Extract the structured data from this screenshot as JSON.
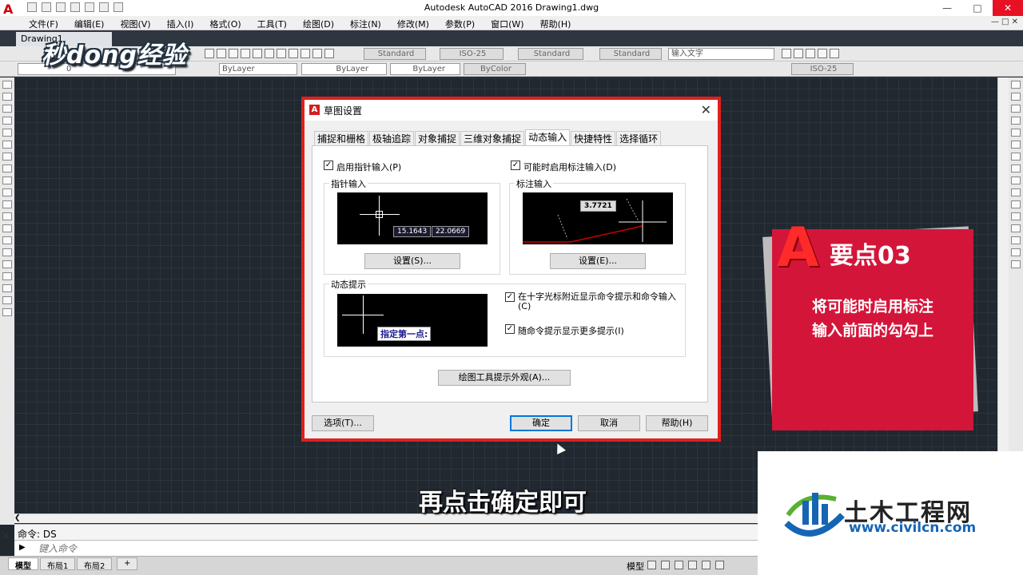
{
  "app": {
    "title": "Autodesk AutoCAD 2016    Drawing1.dwg",
    "logo_letter": "A"
  },
  "menu": [
    "文件(F)",
    "编辑(E)",
    "视图(V)",
    "插入(I)",
    "格式(O)",
    "工具(T)",
    "绘图(D)",
    "标注(N)",
    "修改(M)",
    "参数(P)",
    "窗口(W)",
    "帮助(H)"
  ],
  "doc_tab": "Drawing1",
  "toolbar1": {
    "text_style": "Standard",
    "dim_style": "ISO-25",
    "table_style": "Standard",
    "mleader_style": "Standard",
    "search_placeholder": "输入文字"
  },
  "toolbar2": {
    "layer": "0",
    "color": "ByLayer",
    "linetype": "ByLayer",
    "lineweight": "ByLayer",
    "plotstyle": "ByColor",
    "dim_style": "ISO-25"
  },
  "watermark": "秒dong经验",
  "dialog": {
    "title": "草图设置",
    "tabs": [
      "捕捉和栅格",
      "极轴追踪",
      "对象捕捉",
      "三维对象捕捉",
      "动态输入",
      "快捷特性",
      "选择循环"
    ],
    "active_tab": "动态输入",
    "enable_pointer": "启用指针输入(P)",
    "enable_dim": "可能时启用标注输入(D)",
    "pointer_group": "指针输入",
    "pointer_val1": "15.1643",
    "pointer_val2": "22.0669",
    "pointer_settings": "设置(S)...",
    "dim_group": "标注输入",
    "dim_val": "3.7721",
    "dim_settings": "设置(E)...",
    "tooltip_group": "动态提示",
    "tooltip_text": "指定第一点:",
    "show_prompts": "在十字光标附近显示命令提示和命令输入(C)",
    "show_more": "随命令提示显示更多提示(I)",
    "appearance_btn": "绘图工具提示外观(A)...",
    "options_btn": "选项(T)...",
    "ok_btn": "确定",
    "cancel_btn": "取消",
    "help_btn": "帮助(H)",
    "check_mark": "✓"
  },
  "callout": {
    "head": "要点03",
    "line1": "将可能时启用标注",
    "line2": "输入前面的勾勾上",
    "badge_letter": "A"
  },
  "subtitle": "再点击确定即可",
  "command": {
    "history": "命令:  DS",
    "placeholder": "键入命令"
  },
  "layout_tabs": [
    "模型",
    "布局1",
    "布局2"
  ],
  "status_model": "模型",
  "brand": {
    "name": "土木工程网",
    "url": "www.civilcn.com"
  },
  "colors": {
    "accent_red": "#e0201e",
    "callout_red": "#d4153a",
    "brand_blue": "#1565b5"
  }
}
